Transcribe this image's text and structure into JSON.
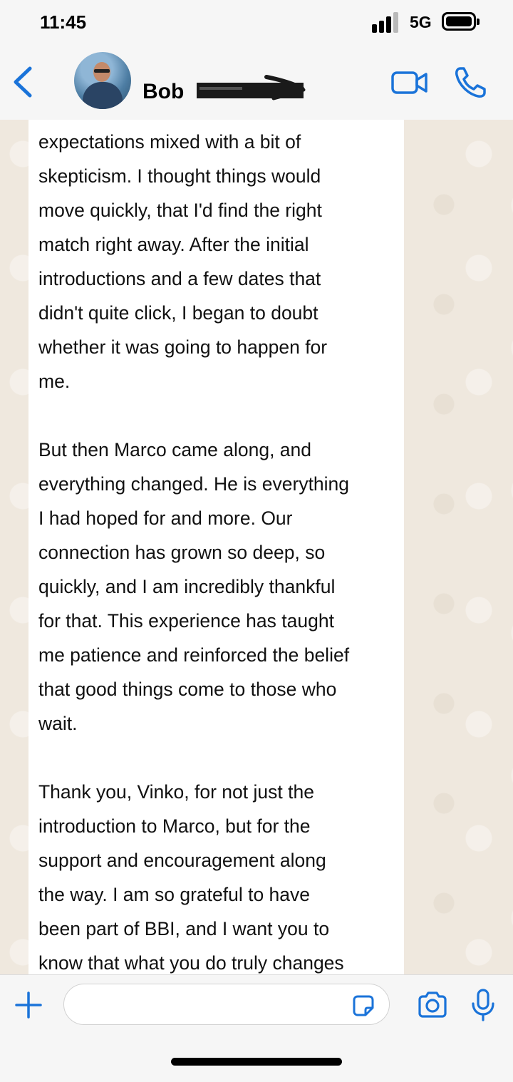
{
  "status_bar": {
    "time": "11:45",
    "network": "5G",
    "signal_bars_filled": 3,
    "signal_bars_total": 4
  },
  "header": {
    "contact_name": "Bob",
    "contact_name_redacted": true,
    "back_icon": "chevron-left-icon",
    "video_icon": "video-camera-icon",
    "phone_icon": "phone-icon",
    "accent_color": "#1a73d9"
  },
  "message": {
    "text": "expectations mixed with a bit of\nskepticism. I thought things would\nmove quickly, that I'd find the right\nmatch right away. After the initial\nintroductions and a few dates that\ndidn't quite click, I began to doubt\nwhether it was going to happen for\nme.\n\nBut then Marco came along, and\neverything changed. He is everything\nI had hoped for and more. Our\nconnection has grown so deep, so\nquickly, and I am incredibly thankful\nfor that. This experience has taught\nme patience and reinforced the belief\nthat good things come to those who\nwait.\n\nThank you, Vinko, for not just the\nintroduction to Marco, but for the\nsupport and encouragement along\nthe way. I am so grateful to have\nbeen part of BBI, and I want you to\nknow that what you do truly changes"
  },
  "input_bar": {
    "placeholder": "",
    "attach_icon": "plus-icon",
    "sticker_icon": "sticker-icon",
    "camera_icon": "camera-icon",
    "mic_icon": "microphone-icon"
  }
}
